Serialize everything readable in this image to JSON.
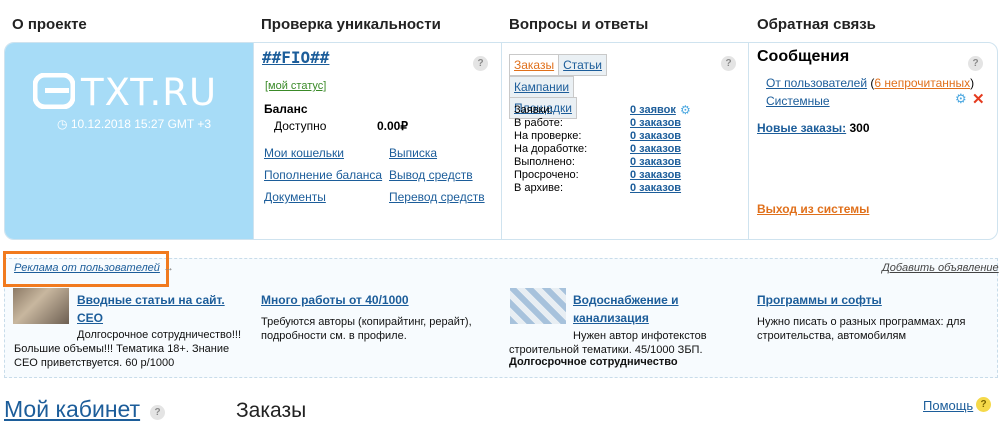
{
  "columns": {
    "about": "О проекте",
    "uniqueness": "Проверка уникальности",
    "qa": "Вопросы и ответы",
    "feedback": "Обратная связь"
  },
  "logo": {
    "text": "TXT.RU",
    "datetime": "10.12.2018 15:27 GMT +3"
  },
  "user": {
    "name": "##FIO##",
    "status_link": "[мой статус]",
    "balance_label": "Баланс",
    "available_label": "Доступно",
    "available_value": "0.00₽",
    "links": [
      "Мои кошельки",
      "Выписка",
      "Пополнение баланса",
      "Вывод средств",
      "Документы",
      "Перевод средств"
    ]
  },
  "tabs": [
    "Заказы",
    "Статьи",
    "Кампании",
    "Площадки"
  ],
  "stats": [
    {
      "label": "Заявки:",
      "value": "0 заявок"
    },
    {
      "label": "В работе:",
      "value": "0 заказов"
    },
    {
      "label": "На проверке:",
      "value": "0 заказов"
    },
    {
      "label": "На доработке:",
      "value": "0 заказов"
    },
    {
      "label": "Выполнено:",
      "value": "0 заказов"
    },
    {
      "label": "Просрочено:",
      "value": "0 заказов"
    },
    {
      "label": "В архиве:",
      "value": "0 заказов"
    }
  ],
  "messages": {
    "title": "Сообщения",
    "from_users": "От пользователей",
    "unread": "6 непрочитанных",
    "system": "Системные",
    "new_orders_label": "Новые заказы:",
    "new_orders_value": "300",
    "logout": "Выход из системы"
  },
  "ads": {
    "section_label": "Реклама от пользователей",
    "add_label": "Добавить объявление",
    "items": [
      {
        "title": "Вводные статьи на сайт. СЕО",
        "text": "Долгосрочное сотрудничество!!! Большие объемы!!! Тематика 18+. Знание СЕО приветствуется. 60 р/1000"
      },
      {
        "title": "Много работы от 40/1000",
        "text": "Требуются авторы (копирайтинг, рерайт), подробности см. в профиле."
      },
      {
        "title": "Водоснабжение и канализация",
        "text": "Нужен автор инфотекстов строительной тематики. 45/1000 ЗБП.",
        "extra": "Долгосрочное сотрудничество"
      },
      {
        "title": "Программы и софты",
        "text": "Нужно писать о разных программах: для строительства, автомобилям"
      }
    ]
  },
  "footer": {
    "cabinet": "Мой кабинет",
    "orders": "Заказы",
    "help": "Помощь"
  },
  "qmark": "?"
}
